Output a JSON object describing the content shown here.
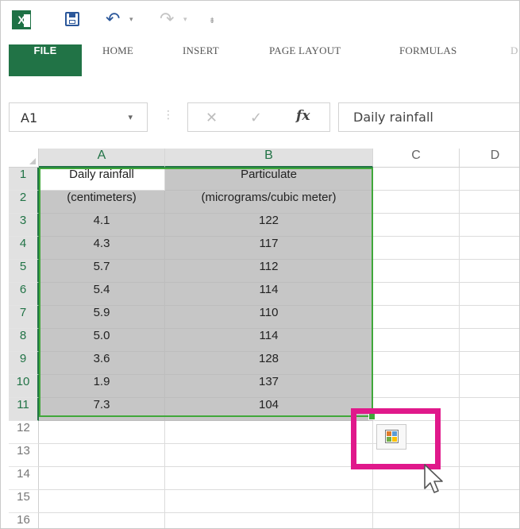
{
  "app": {
    "quick_access": {
      "excel_icon": "excel-logo-icon",
      "save_icon": "save-icon",
      "undo_glyph": "↶",
      "redo_glyph": "↷",
      "dropdown_glyph": "▾",
      "customize_glyph": "⇟"
    },
    "ribbon": {
      "tabs": [
        {
          "label": "FILE",
          "active": true
        },
        {
          "label": "HOME"
        },
        {
          "label": "INSERT"
        },
        {
          "label": "PAGE LAYOUT"
        },
        {
          "label": "FORMULAS"
        },
        {
          "label": "D"
        }
      ],
      "accent_color": "#217346"
    },
    "formula_bar": {
      "name_box": "A1",
      "name_box_dropdown": "▾",
      "separator": "⋮",
      "cancel_glyph": "✕",
      "enter_glyph": "✓",
      "fx_label": "fx",
      "formula_value": "Daily rainfall"
    }
  },
  "sheet": {
    "columns": [
      "A",
      "B",
      "C",
      "D"
    ],
    "rows": [
      "1",
      "2",
      "3",
      "4",
      "5",
      "6",
      "7",
      "8",
      "9",
      "10",
      "11",
      "12",
      "13",
      "14",
      "15",
      "16"
    ],
    "cells": {
      "A": [
        "Daily rainfall",
        "(centimeters)",
        "4.1",
        "4.3",
        "5.7",
        "5.4",
        "5.9",
        "5.0",
        "3.6",
        "1.9",
        "7.3"
      ],
      "B": [
        "Particulate",
        "(micrograms/cubic meter)",
        "122",
        "117",
        "112",
        "114",
        "110",
        "114",
        "128",
        "137",
        "104"
      ]
    },
    "selection": "A1:B11",
    "selection_color": "#40a83a"
  },
  "overlay": {
    "quick_analysis_icon": "quick-analysis-icon",
    "highlight_color": "#e0198b",
    "cursor_icon": "mouse-pointer-icon"
  }
}
